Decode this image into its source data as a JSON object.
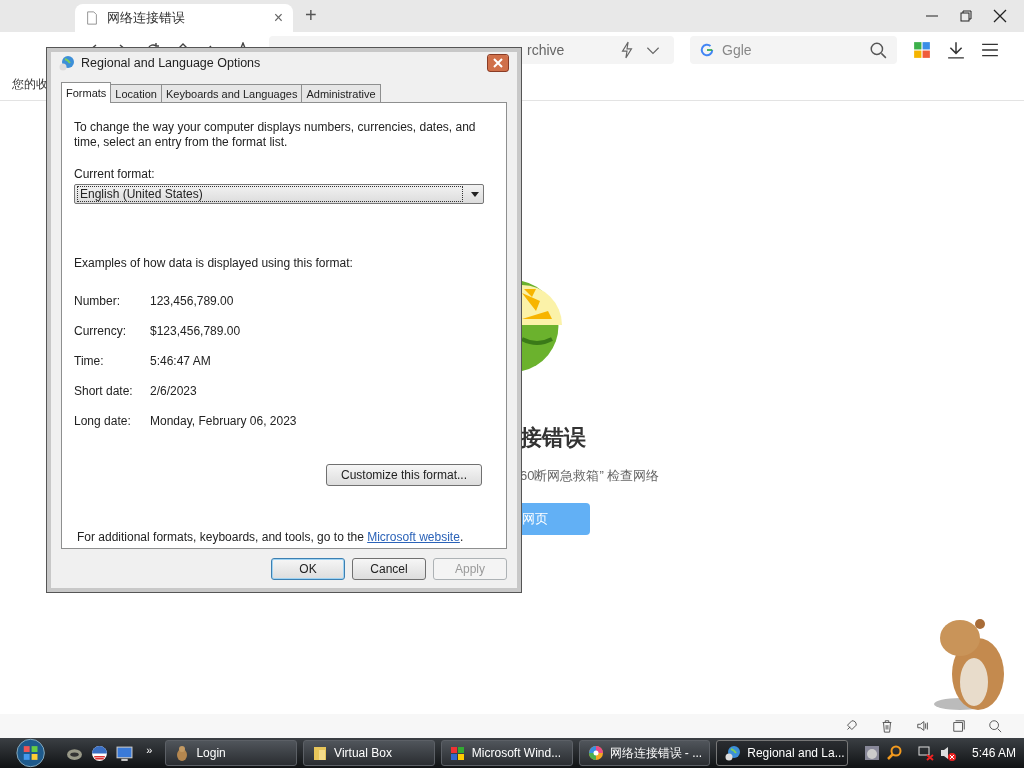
{
  "browser": {
    "tab": {
      "title": "网络连接错误",
      "close": "×"
    },
    "new_tab": "+",
    "address": {
      "value": "rchive"
    },
    "search": {
      "placeholder": "Ggle"
    },
    "bookmarks": [
      "您的收"
    ],
    "page": {
      "heading": "接错误",
      "message": "60断网急救箱” 检查网络",
      "button": "网页"
    }
  },
  "dialog": {
    "title": "Regional and Language Options",
    "tabs": [
      {
        "label": "Formats",
        "selected": true
      },
      {
        "label": "Location",
        "selected": false
      },
      {
        "label": "Keyboards and Languages",
        "selected": false
      },
      {
        "label": "Administrative",
        "selected": false
      }
    ],
    "intro": "To change the way your computer displays numbers, currencies, dates, and time, select an entry from the format list.",
    "current_format_label": "Current format:",
    "current_format": "English (United States)",
    "examples_label": "Examples of how data is displayed using this format:",
    "examples": [
      {
        "label": "Number:",
        "value": "123,456,789.00"
      },
      {
        "label": "Currency:",
        "value": "$123,456,789.00"
      },
      {
        "label": "Time:",
        "value": "5:46:47 AM"
      },
      {
        "label": "Short date:",
        "value": "2/6/2023"
      },
      {
        "label": "Long date:",
        "value": "Monday, February 06, 2023"
      }
    ],
    "customize_button": "Customize this format...",
    "footer": {
      "text": "For additional formats, keyboards, and tools, go to the ",
      "link": "Microsoft website",
      "end": "."
    },
    "buttons": [
      {
        "label": "OK",
        "kind": "default",
        "disabled": false
      },
      {
        "label": "Cancel",
        "kind": "normal",
        "disabled": false
      },
      {
        "label": "Apply",
        "kind": "normal",
        "disabled": true
      }
    ]
  },
  "taskbar": {
    "overflow": "»",
    "items": [
      {
        "label": "Login",
        "kind": "pet",
        "selected": false
      },
      {
        "label": "Virtual Box",
        "kind": "folder",
        "selected": false
      },
      {
        "label": "Microsoft Wind...",
        "kind": "windows",
        "selected": false
      },
      {
        "label": "网络连接错误 - ...",
        "kind": "browser",
        "selected": false
      },
      {
        "label": "Regional and La...",
        "kind": "globe",
        "selected": true
      }
    ],
    "clock": "5:46 AM"
  }
}
